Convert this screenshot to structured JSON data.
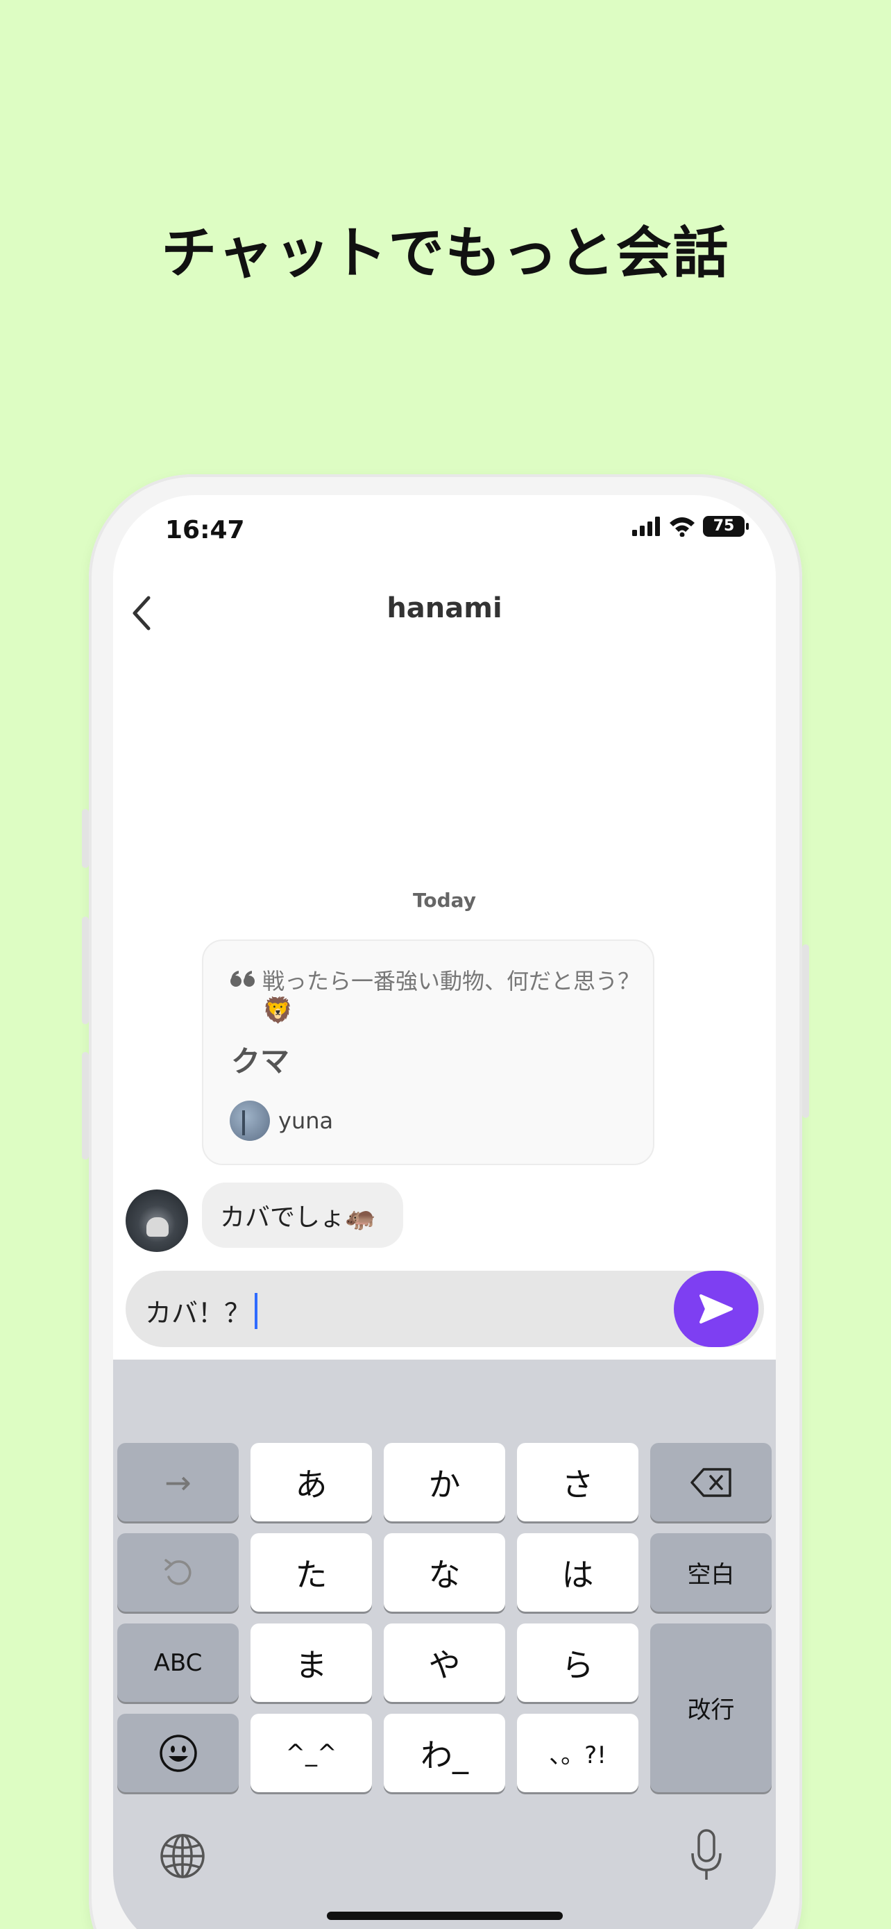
{
  "headline": "チャットでもっと会話",
  "status": {
    "time": "16:47",
    "battery": "75"
  },
  "nav": {
    "title": "hanami"
  },
  "chat": {
    "date_label": "Today",
    "quote": {
      "question": "戦ったら一番強い動物、何だと思う？",
      "emoji": "🦁",
      "answer": "クマ",
      "username": "yuna"
    },
    "message": "カバでしょ🦛"
  },
  "input": {
    "value": "カバ！？"
  },
  "keyboard": {
    "keys": {
      "arrow": "→",
      "a": "あ",
      "ka": "か",
      "sa": "さ",
      "ta": "た",
      "na": "な",
      "ha": "は",
      "space": "空白",
      "abc": "ABC",
      "ma": "ま",
      "ya": "や",
      "ra": "ら",
      "enter": "改行",
      "kaomoji": "^_^",
      "wa": "わ_",
      "punct": "、。?!"
    }
  },
  "colors": {
    "background": "#ddfdc3",
    "accent": "#7e3ff2"
  }
}
